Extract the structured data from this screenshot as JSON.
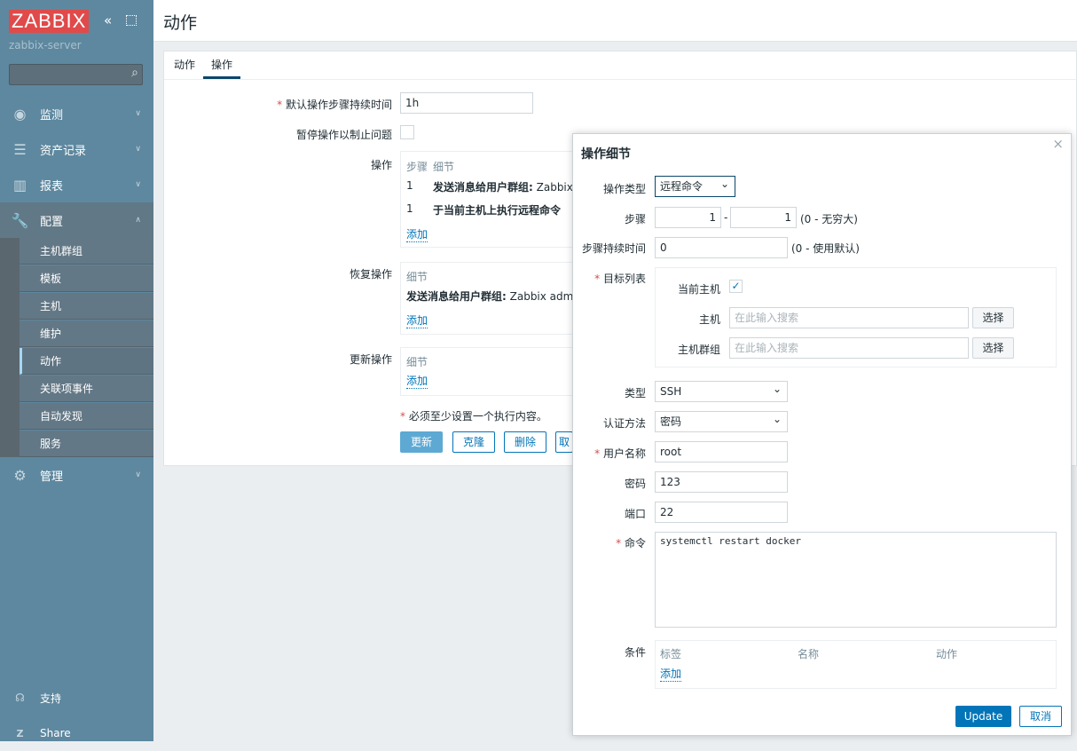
{
  "sidebar": {
    "logo": "ZABBIX",
    "server": "zabbix-server",
    "menu": [
      {
        "label": "监测",
        "icon": "eye-icon"
      },
      {
        "label": "资产记录",
        "icon": "list-icon"
      },
      {
        "label": "报表",
        "icon": "chart-icon"
      },
      {
        "label": "配置",
        "icon": "wrench-icon"
      },
      {
        "label": "管理",
        "icon": "gear-icon"
      }
    ],
    "submenu": [
      "主机群组",
      "模板",
      "主机",
      "维护",
      "动作",
      "关联项事件",
      "自动发现",
      "服务"
    ],
    "bottom": [
      {
        "label": "支持",
        "icon": "headset-icon"
      },
      {
        "label": "Share",
        "icon": "share-icon"
      }
    ]
  },
  "header": {
    "title": "动作"
  },
  "tabs": [
    "动作",
    "操作"
  ],
  "form": {
    "duration_label": "默认操作步骤持续时间",
    "duration_value": "1h",
    "pause_label": "暂停操作以制止问题",
    "ops_label": "操作",
    "col_step": "步骤",
    "col_detail": "细节",
    "ops": [
      {
        "step": "1",
        "bold": "发送消息给用户群组:",
        "rest": " Zabbix a"
      },
      {
        "step": "1",
        "bold": "于当前主机上执行远程命令",
        "rest": ""
      }
    ],
    "add": "添加",
    "recovery_label": "恢复操作",
    "recovery_bold": "发送消息给用户群组:",
    "recovery_rest": " Zabbix admin",
    "update_label": "更新操作",
    "note": "必须至少设置一个执行内容。",
    "buttons": [
      "更新",
      "克隆",
      "删除",
      "取"
    ]
  },
  "dialog": {
    "title": "操作细节",
    "close": "×",
    "type_label": "操作类型",
    "type_value": "远程命令",
    "steps_label": "步骤",
    "step_from": "1",
    "step_to": "1",
    "steps_hint": "(0 - 无穷大)",
    "dur_label": "步骤持续时间",
    "dur_value": "0",
    "dur_hint": "(0 - 使用默认)",
    "targets_label": "目标列表",
    "current_host": "当前主机",
    "host": "主机",
    "hostgroup": "主机群组",
    "search_ph": "在此输入搜索",
    "select": "选择",
    "conn_label": "类型",
    "conn_value": "SSH",
    "auth_label": "认证方法",
    "auth_value": "密码",
    "user_label": "用户名称",
    "user_value": "root",
    "pass_label": "密码",
    "pass_value": "123",
    "port_label": "端口",
    "port_value": "22",
    "cmd_label": "命令",
    "cmd_value": "systemctl restart docker",
    "cond_label": "条件",
    "cond_cols": [
      "标签",
      "名称",
      "动作"
    ],
    "cond_add": "添加",
    "update": "Update",
    "cancel": "取消"
  }
}
